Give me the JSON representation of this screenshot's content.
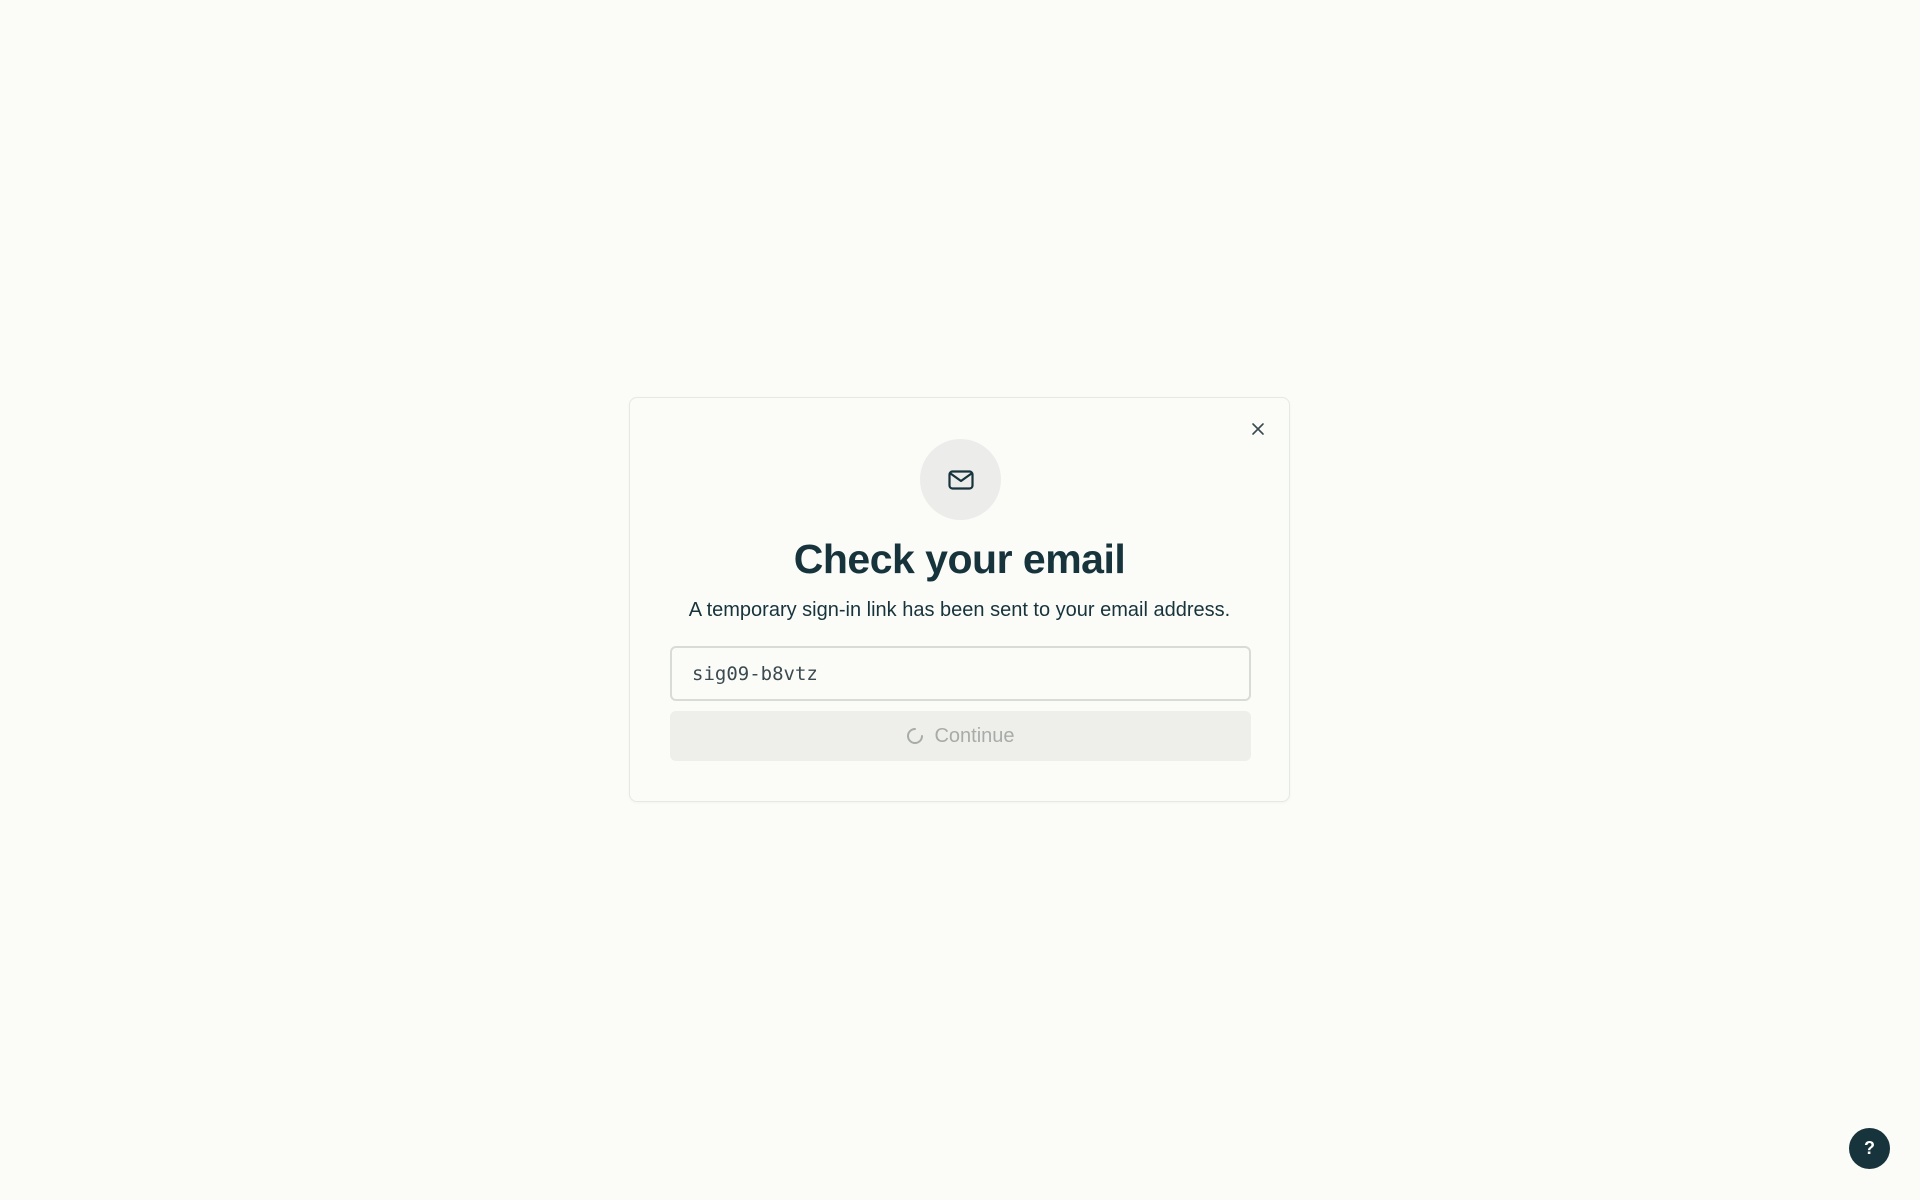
{
  "dialog": {
    "close_icon": "close-icon",
    "mail_icon": "mail-icon",
    "title": "Check your email",
    "subtitle": "A temporary sign-in link has been sent to your email address.",
    "code_value": "sig09-b8vtz",
    "continue_label": "Continue",
    "spinner_icon": "spinner-icon"
  },
  "help": {
    "label": "?"
  },
  "colors": {
    "background": "#fbfcf8",
    "primary_text": "#17333b",
    "disabled_button": "#eeefeb",
    "disabled_text": "#a8aca8"
  }
}
